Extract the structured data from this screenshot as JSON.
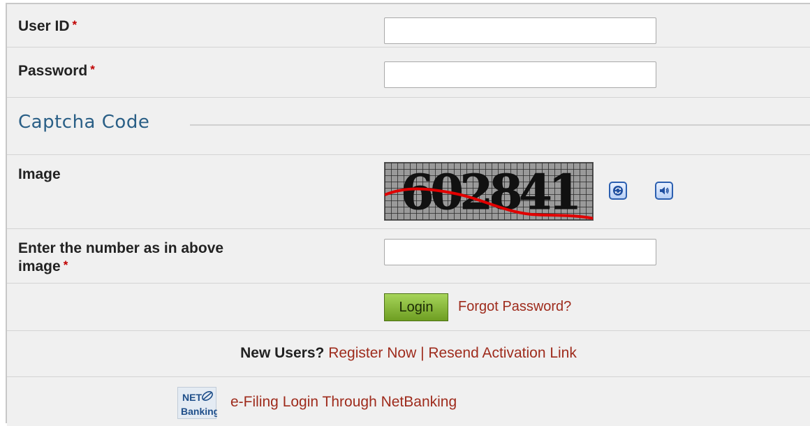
{
  "form": {
    "user_id": {
      "label": "User ID",
      "required_mark": "*",
      "value": ""
    },
    "password": {
      "label": "Password",
      "required_mark": "*",
      "value": ""
    },
    "captcha_section": {
      "legend": "Captcha Code"
    },
    "image_row": {
      "label": "Image",
      "captcha_text": "602841"
    },
    "captcha_input": {
      "label_line1": "Enter the number as in above",
      "label_line2": "image",
      "required_mark": "*",
      "value": ""
    },
    "actions": {
      "login_label": "Login",
      "forgot_password": "Forgot Password?"
    },
    "new_users": {
      "prefix": "New Users?",
      "register": "Register Now",
      "separator": "|",
      "resend": "Resend Activation Link"
    },
    "netbanking": {
      "logo_line1": "NET",
      "logo_line2": "Banking",
      "link": "e-Filing Login Through NetBanking"
    }
  },
  "icons": {
    "refresh": "refresh-icon",
    "audio": "speaker-icon",
    "netbanking_logo": "netbanking-logo"
  },
  "colors": {
    "label": "#222222",
    "required": "#c00000",
    "link": "#9e2b1c",
    "legend": "#2a5f86",
    "login_button": "#8bbd3b"
  }
}
